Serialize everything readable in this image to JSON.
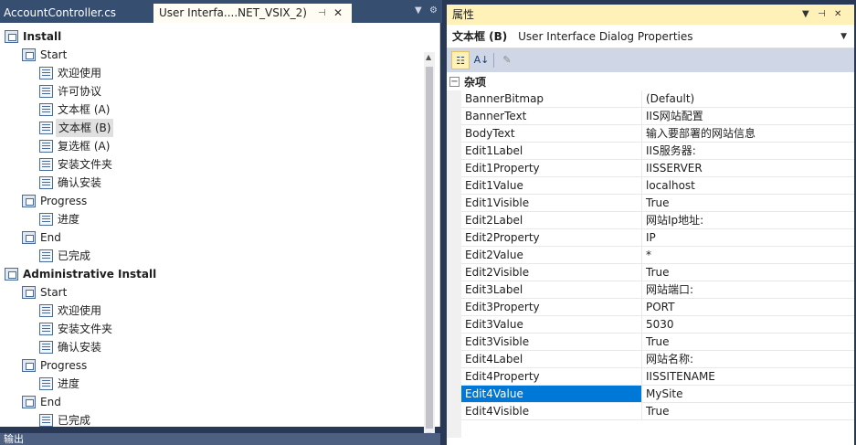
{
  "tabs": [
    {
      "label": "AccountController.cs"
    },
    {
      "label": "User Interfa....NET_VSIX_2)"
    }
  ],
  "tree": [
    {
      "label": "Install",
      "bold": true
    },
    {
      "label": "Start"
    },
    {
      "label": "欢迎使用"
    },
    {
      "label": "许可协议"
    },
    {
      "label": "文本框 (A)"
    },
    {
      "label": "文本框 (B)",
      "selected": true
    },
    {
      "label": "复选框 (A)"
    },
    {
      "label": "安装文件夹"
    },
    {
      "label": "确认安装"
    },
    {
      "label": "Progress"
    },
    {
      "label": "进度"
    },
    {
      "label": "End"
    },
    {
      "label": "已完成"
    },
    {
      "label": "Administrative Install",
      "bold": true
    },
    {
      "label": "Start"
    },
    {
      "label": "欢迎使用"
    },
    {
      "label": "安装文件夹"
    },
    {
      "label": "确认安装"
    },
    {
      "label": "Progress"
    },
    {
      "label": "进度"
    },
    {
      "label": "End"
    },
    {
      "label": "已完成"
    }
  ],
  "output_header": "输出",
  "properties": {
    "title": "属性",
    "object_name": "文本框 (B)",
    "object_type": "User Interface Dialog Properties",
    "category": "杂项",
    "rows": [
      {
        "name": "BannerBitmap",
        "value": "(Default)"
      },
      {
        "name": "BannerText",
        "value": "IIS网站配置"
      },
      {
        "name": "BodyText",
        "value": "输入要部署的网站信息"
      },
      {
        "name": "Edit1Label",
        "value": "IIS服务器:"
      },
      {
        "name": "Edit1Property",
        "value": "IISSERVER"
      },
      {
        "name": "Edit1Value",
        "value": "localhost"
      },
      {
        "name": "Edit1Visible",
        "value": "True"
      },
      {
        "name": "Edit2Label",
        "value": "网站Ip地址:"
      },
      {
        "name": "Edit2Property",
        "value": "IP"
      },
      {
        "name": "Edit2Value",
        "value": "*"
      },
      {
        "name": "Edit2Visible",
        "value": "True"
      },
      {
        "name": "Edit3Label",
        "value": "网站端口:"
      },
      {
        "name": "Edit3Property",
        "value": "PORT"
      },
      {
        "name": "Edit3Value",
        "value": "5030"
      },
      {
        "name": "Edit3Visible",
        "value": "True"
      },
      {
        "name": "Edit4Label",
        "value": "网站名称:"
      },
      {
        "name": "Edit4Property",
        "value": "IISSITENAME"
      },
      {
        "name": "Edit4Value",
        "value": "MySite",
        "selected": true
      },
      {
        "name": "Edit4Visible",
        "value": "True"
      }
    ]
  },
  "colors": {
    "accent": "#0078d7",
    "chrome": "#293955",
    "active_title": "#fff1b8"
  }
}
